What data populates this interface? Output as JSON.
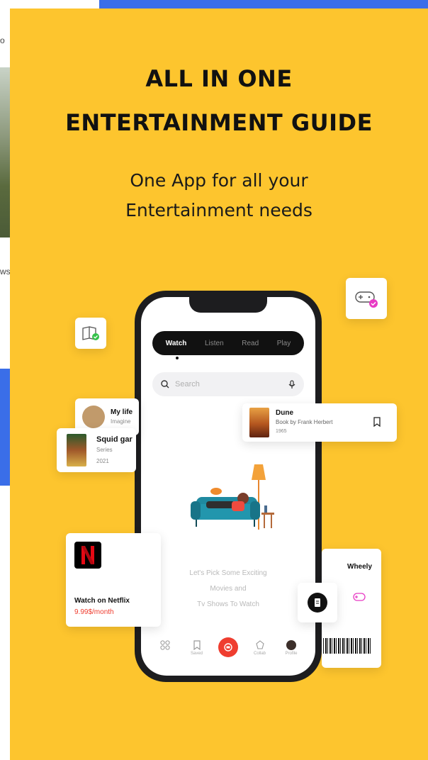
{
  "background": {
    "left_fragments": [
      "o",
      "ws"
    ],
    "accent_color": "#fdc52e",
    "blue_color": "#3a6ee8"
  },
  "promo": {
    "headline_line1": "ALL IN ONE",
    "headline_line2": "ENTERTAINMENT GUIDE",
    "subtitle_line1": "One App for all your",
    "subtitle_line2": "Entertainment needs"
  },
  "app": {
    "tabs": [
      {
        "label": "Watch",
        "active": true
      },
      {
        "label": "Listen",
        "active": false
      },
      {
        "label": "Read",
        "active": false
      },
      {
        "label": "Play",
        "active": false
      }
    ],
    "search": {
      "placeholder": "Search",
      "icon": "search-icon",
      "mic_icon": "microphone-icon"
    },
    "empty_state": {
      "line1": "Let's Pick Some Exciting",
      "line2": "Movies and",
      "line3": "Tv Shows To Watch"
    },
    "bottom_nav": [
      {
        "icon": "grid-icon",
        "label": ""
      },
      {
        "icon": "bookmark-icon",
        "label": "Saved"
      },
      {
        "icon": "record-icon",
        "label": ""
      },
      {
        "icon": "collab-icon",
        "label": "Collab"
      },
      {
        "icon": "avatar",
        "label": "Profile"
      }
    ],
    "accent_red": "#ef3d2f"
  },
  "cards": {
    "my_life": {
      "title": "My life",
      "subtitle": "Imagine"
    },
    "squid": {
      "title": "Squid gar",
      "type": "Series",
      "year": "2021"
    },
    "dune": {
      "title": "Dune",
      "subtitle": "Book by Frank Herbert",
      "year": "1965"
    },
    "netflix": {
      "title": "Watch on Netflix",
      "price": "9.99$/month",
      "logo": "N"
    },
    "whely": {
      "title": "Wheely"
    }
  }
}
